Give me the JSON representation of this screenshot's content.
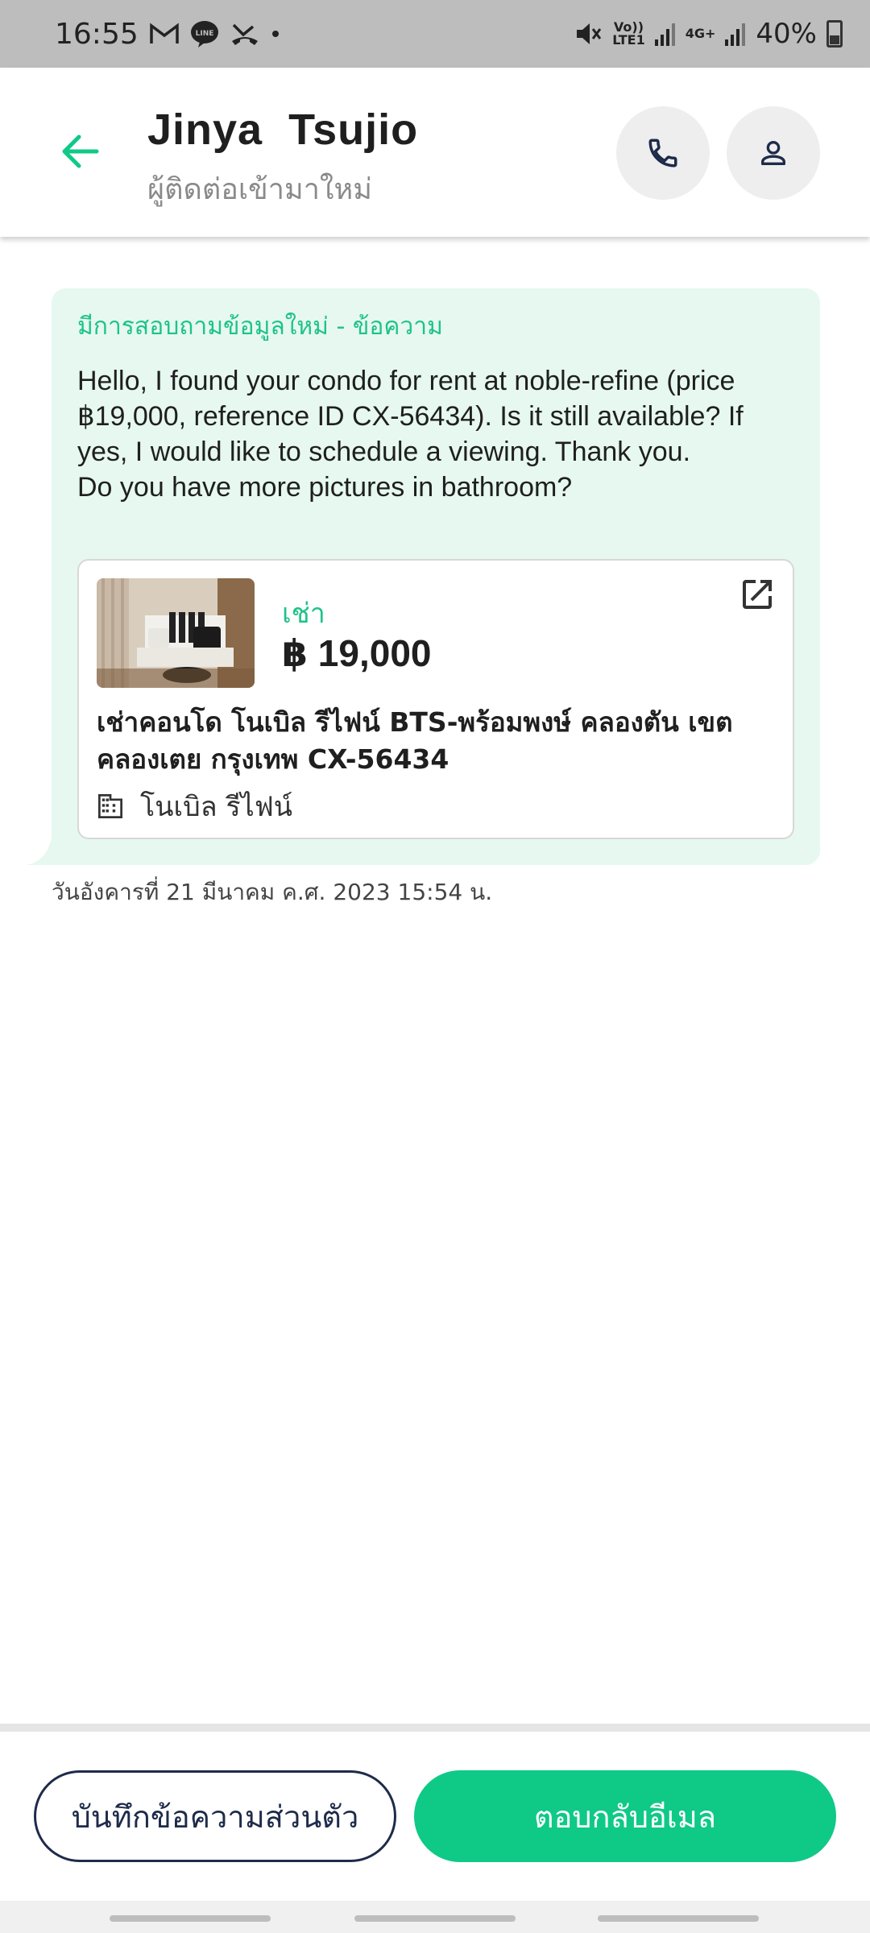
{
  "status_bar": {
    "time": "16:55",
    "volte_label": "Vo))\nLTE1",
    "network_label": "4G+",
    "battery": "40%"
  },
  "header": {
    "contact_name": "Jinya  Tsujio",
    "contact_status": "ผู้ติดต่อเข้ามาใหม่"
  },
  "message": {
    "heading": "มีการสอบถามข้อมูลใหม่ - ข้อความ",
    "body": "Hello, I found your condo for rent at noble-refine (price ฿19,000, reference ID CX-56434). Is it still available? If yes, I would like to schedule a viewing. Thank you.\nDo you have more pictures in bathroom?",
    "timestamp": "วันอังคารที่ 21 มีนาคม ค.ศ. 2023 15:54 น."
  },
  "listing": {
    "type": "เช่า",
    "price": "฿ 19,000",
    "title": "เช่าคอนโด  โนเบิล รีไฟน์ BTS-พร้อมพงษ์ คลองตัน เขต คลองเตย กรุงเทพ CX-56434",
    "project": "โนเบิล รีไฟน์"
  },
  "actions": {
    "note_label": "บันทึกข้อความส่วนตัว",
    "reply_label": "ตอบกลับอีเมล"
  },
  "colors": {
    "accent": "#0fc987",
    "bubble_bg": "#e6f8f0",
    "dark_outline": "#1e2b4a"
  },
  "icons": {
    "back": "arrow-left-icon",
    "call": "phone-icon",
    "profile": "person-icon",
    "external": "open-external-icon",
    "building": "building-icon"
  }
}
